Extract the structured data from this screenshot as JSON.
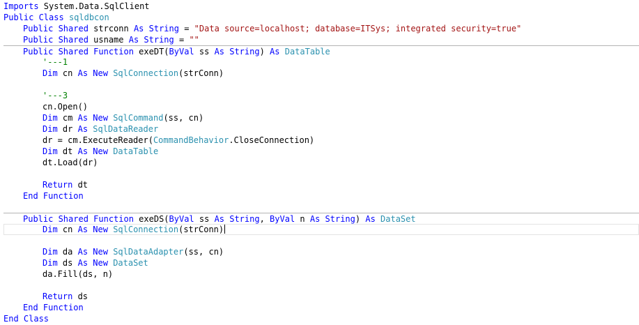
{
  "editor": {
    "lines": [
      {
        "indent": 0,
        "tokens": [
          {
            "t": "Imports",
            "c": "k"
          },
          {
            "t": " System.Data.SqlClient",
            "c": "p"
          }
        ]
      },
      {
        "indent": 0,
        "tokens": [
          {
            "t": "Public Class",
            "c": "k"
          },
          {
            "t": " ",
            "c": "p"
          },
          {
            "t": "sqldbcon",
            "c": "t"
          }
        ]
      },
      {
        "indent": 1,
        "tokens": [
          {
            "t": "Public Shared",
            "c": "k"
          },
          {
            "t": " strconn ",
            "c": "p"
          },
          {
            "t": "As String",
            "c": "k"
          },
          {
            "t": " = ",
            "c": "p"
          },
          {
            "t": "\"Data source=localhost; database=ITSys; integrated security=true\"",
            "c": "s"
          }
        ]
      },
      {
        "indent": 1,
        "tokens": [
          {
            "t": "Public Shared",
            "c": "k"
          },
          {
            "t": " usname ",
            "c": "p"
          },
          {
            "t": "As String",
            "c": "k"
          },
          {
            "t": " = ",
            "c": "p"
          },
          {
            "t": "\"\"",
            "c": "s"
          }
        ]
      },
      {
        "indent": 1,
        "sep": true,
        "tokens": [
          {
            "t": "Public Shared Function",
            "c": "k"
          },
          {
            "t": " exeDT(",
            "c": "p"
          },
          {
            "t": "ByVal",
            "c": "k"
          },
          {
            "t": " ss ",
            "c": "p"
          },
          {
            "t": "As String",
            "c": "k"
          },
          {
            "t": ") ",
            "c": "p"
          },
          {
            "t": "As",
            "c": "k"
          },
          {
            "t": " ",
            "c": "p"
          },
          {
            "t": "DataTable",
            "c": "t"
          }
        ]
      },
      {
        "indent": 2,
        "tokens": [
          {
            "t": "'---1",
            "c": "c"
          }
        ]
      },
      {
        "indent": 2,
        "tokens": [
          {
            "t": "Dim",
            "c": "k"
          },
          {
            "t": " cn ",
            "c": "p"
          },
          {
            "t": "As New",
            "c": "k"
          },
          {
            "t": " ",
            "c": "p"
          },
          {
            "t": "SqlConnection",
            "c": "t"
          },
          {
            "t": "(strConn)",
            "c": "p"
          }
        ]
      },
      {
        "indent": 0,
        "tokens": []
      },
      {
        "indent": 2,
        "tokens": [
          {
            "t": "'---3",
            "c": "c"
          }
        ]
      },
      {
        "indent": 2,
        "tokens": [
          {
            "t": "cn.Open()",
            "c": "p"
          }
        ]
      },
      {
        "indent": 2,
        "tokens": [
          {
            "t": "Dim",
            "c": "k"
          },
          {
            "t": " cm ",
            "c": "p"
          },
          {
            "t": "As New",
            "c": "k"
          },
          {
            "t": " ",
            "c": "p"
          },
          {
            "t": "SqlCommand",
            "c": "t"
          },
          {
            "t": "(ss, cn)",
            "c": "p"
          }
        ]
      },
      {
        "indent": 2,
        "tokens": [
          {
            "t": "Dim",
            "c": "k"
          },
          {
            "t": " dr ",
            "c": "p"
          },
          {
            "t": "As",
            "c": "k"
          },
          {
            "t": " ",
            "c": "p"
          },
          {
            "t": "SqlDataReader",
            "c": "t"
          }
        ]
      },
      {
        "indent": 2,
        "tokens": [
          {
            "t": "dr = cm.ExecuteReader(",
            "c": "p"
          },
          {
            "t": "CommandBehavior",
            "c": "t"
          },
          {
            "t": ".CloseConnection)",
            "c": "p"
          }
        ]
      },
      {
        "indent": 2,
        "tokens": [
          {
            "t": "Dim",
            "c": "k"
          },
          {
            "t": " dt ",
            "c": "p"
          },
          {
            "t": "As New",
            "c": "k"
          },
          {
            "t": " ",
            "c": "p"
          },
          {
            "t": "DataTable",
            "c": "t"
          }
        ]
      },
      {
        "indent": 2,
        "tokens": [
          {
            "t": "dt.Load(dr)",
            "c": "p"
          }
        ]
      },
      {
        "indent": 0,
        "tokens": []
      },
      {
        "indent": 2,
        "tokens": [
          {
            "t": "Return",
            "c": "k"
          },
          {
            "t": " dt",
            "c": "p"
          }
        ]
      },
      {
        "indent": 1,
        "tokens": [
          {
            "t": "End Function",
            "c": "k"
          }
        ]
      },
      {
        "indent": 0,
        "tokens": []
      },
      {
        "indent": 1,
        "sep": true,
        "tokens": [
          {
            "t": "Public Shared Function",
            "c": "k"
          },
          {
            "t": " exeDS(",
            "c": "p"
          },
          {
            "t": "ByVal",
            "c": "k"
          },
          {
            "t": " ss ",
            "c": "p"
          },
          {
            "t": "As String",
            "c": "k"
          },
          {
            "t": ", ",
            "c": "p"
          },
          {
            "t": "ByVal",
            "c": "k"
          },
          {
            "t": " n ",
            "c": "p"
          },
          {
            "t": "As String",
            "c": "k"
          },
          {
            "t": ") ",
            "c": "p"
          },
          {
            "t": "As",
            "c": "k"
          },
          {
            "t": " ",
            "c": "p"
          },
          {
            "t": "DataSet",
            "c": "t"
          }
        ]
      },
      {
        "indent": 2,
        "current": true,
        "caret": true,
        "tokens": [
          {
            "t": "Dim",
            "c": "k"
          },
          {
            "t": " cn ",
            "c": "p"
          },
          {
            "t": "As New",
            "c": "k"
          },
          {
            "t": " ",
            "c": "p"
          },
          {
            "t": "SqlConnection",
            "c": "t"
          },
          {
            "t": "(strConn)",
            "c": "p"
          }
        ]
      },
      {
        "indent": 0,
        "tokens": []
      },
      {
        "indent": 2,
        "tokens": [
          {
            "t": "Dim",
            "c": "k"
          },
          {
            "t": " da ",
            "c": "p"
          },
          {
            "t": "As New",
            "c": "k"
          },
          {
            "t": " ",
            "c": "p"
          },
          {
            "t": "SqlDataAdapter",
            "c": "t"
          },
          {
            "t": "(ss, cn)",
            "c": "p"
          }
        ]
      },
      {
        "indent": 2,
        "tokens": [
          {
            "t": "Dim",
            "c": "k"
          },
          {
            "t": " ds ",
            "c": "p"
          },
          {
            "t": "As New",
            "c": "k"
          },
          {
            "t": " ",
            "c": "p"
          },
          {
            "t": "DataSet",
            "c": "t"
          }
        ]
      },
      {
        "indent": 2,
        "tokens": [
          {
            "t": "da.Fill(ds, n)",
            "c": "p"
          }
        ]
      },
      {
        "indent": 0,
        "tokens": []
      },
      {
        "indent": 2,
        "tokens": [
          {
            "t": "Return",
            "c": "k"
          },
          {
            "t": " ds",
            "c": "p"
          }
        ]
      },
      {
        "indent": 1,
        "tokens": [
          {
            "t": "End Function",
            "c": "k"
          }
        ]
      },
      {
        "indent": 0,
        "tokens": [
          {
            "t": "End Class",
            "c": "k"
          }
        ]
      }
    ],
    "colors": {
      "keyword": "#0000ff",
      "type": "#2b91af",
      "string": "#a31515",
      "comment": "#008000",
      "plain": "#000000"
    }
  }
}
